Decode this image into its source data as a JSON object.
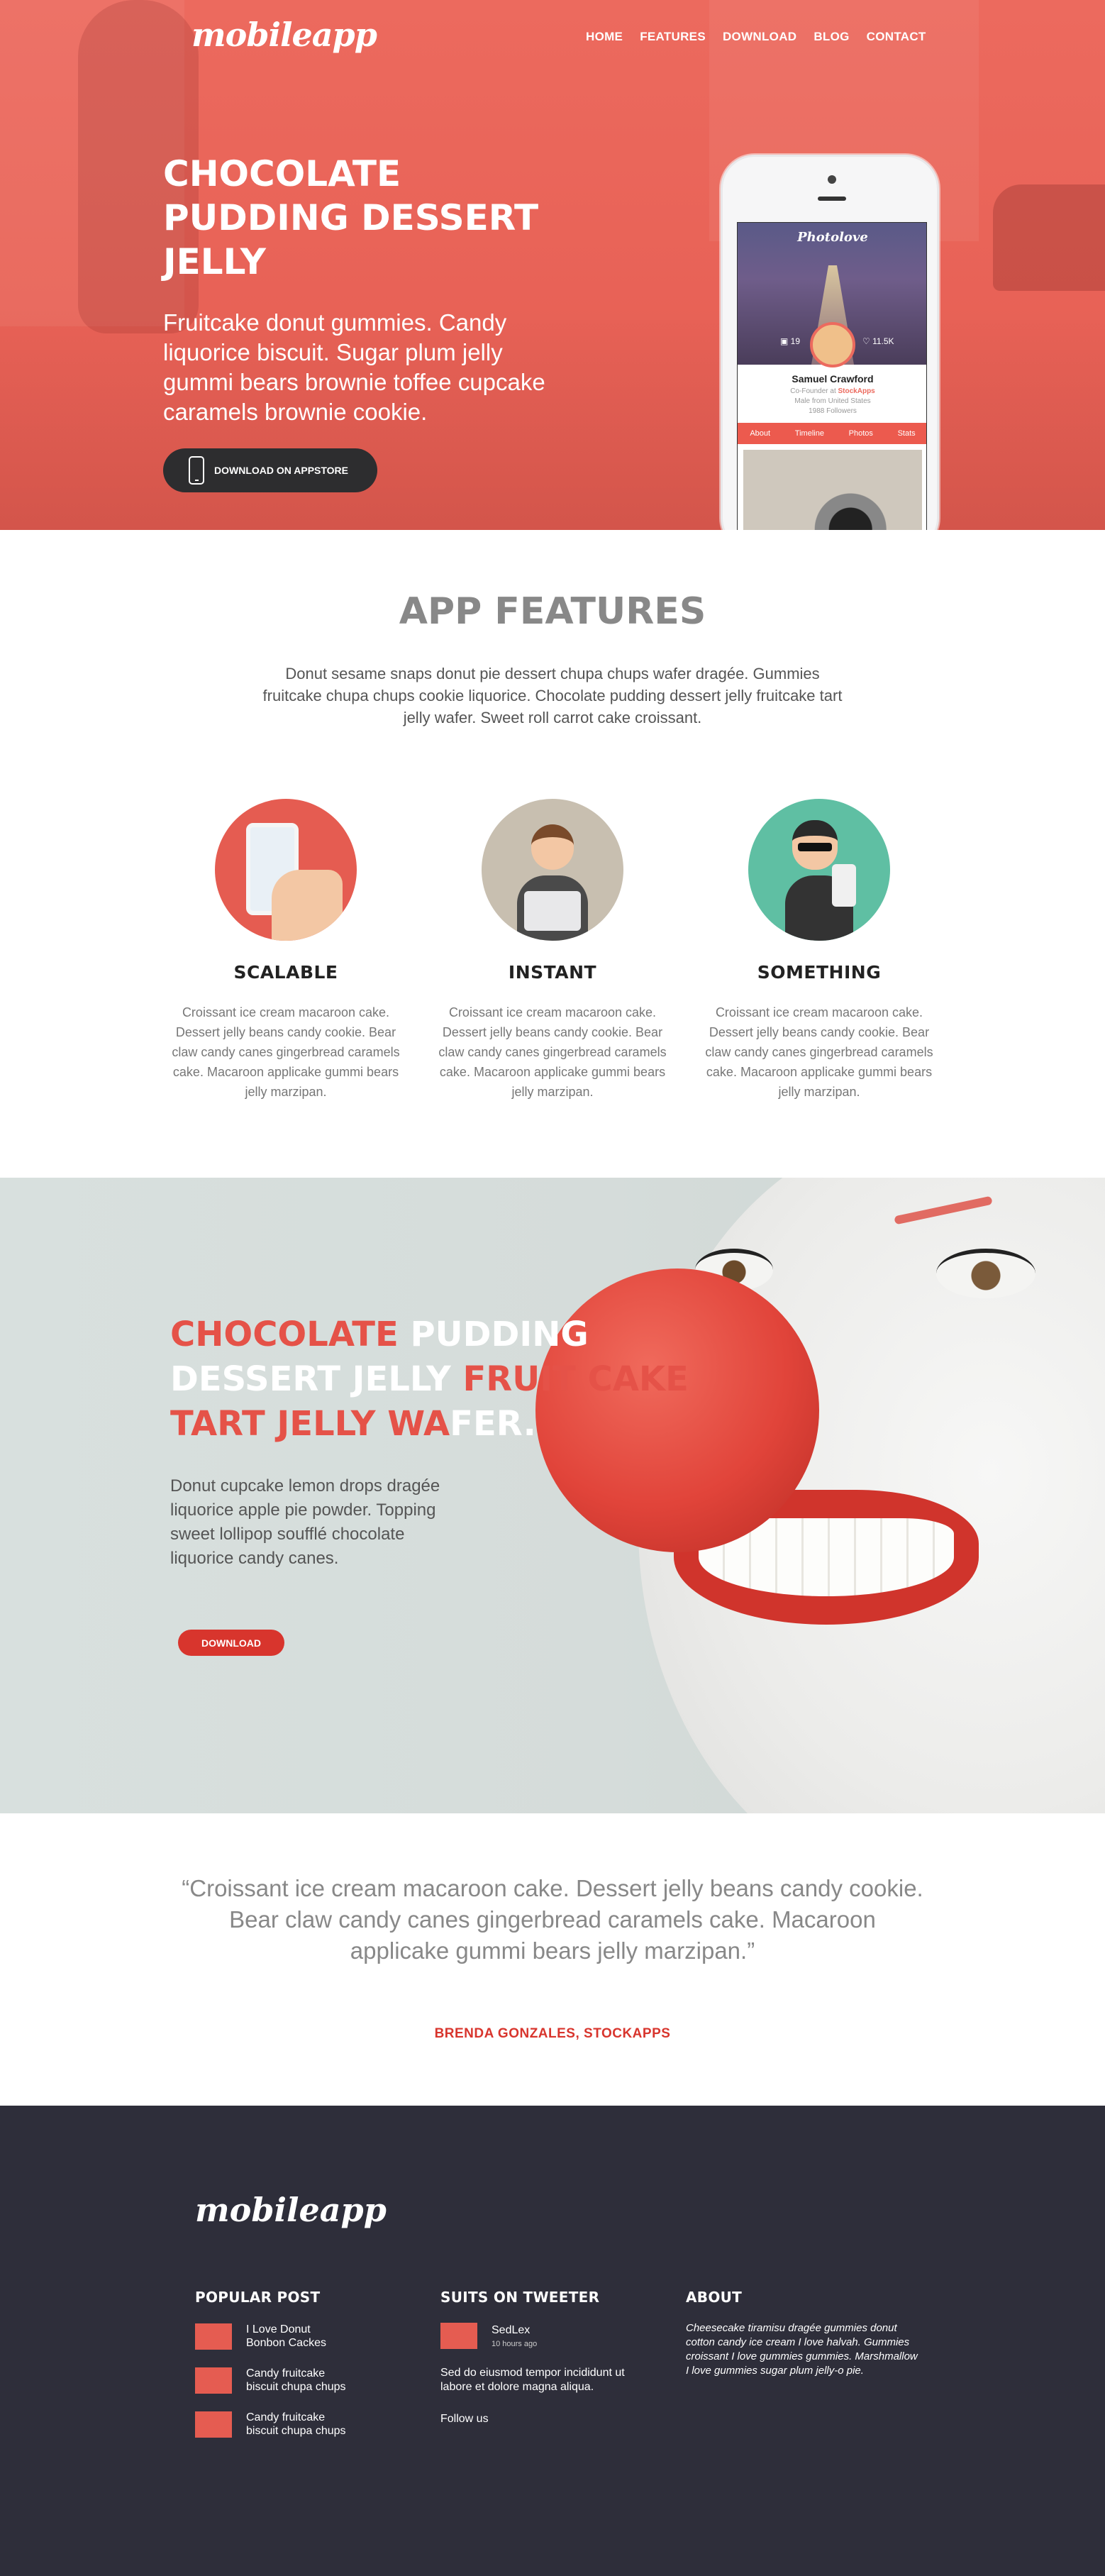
{
  "brand": {
    "logo": "mobileapp",
    "accent": "#e55c51",
    "dark": "#2e2e3a"
  },
  "nav": {
    "items": [
      "HOME",
      "FEATURES",
      "DOWNLOAD",
      "BLOG",
      "CONTACT"
    ]
  },
  "hero": {
    "title": "CHOCOLATE PUDDING DESSERT JELLY",
    "subtitle": "Fruitcake donut gummies. Candy liquorice biscuit. Sugar plum jelly gummi bears brownie toffee cupcake caramels brownie cookie.",
    "button": "DOWNLOAD ON APPSTORE",
    "phone": {
      "app_name": "Photolove",
      "stat_left": "19",
      "stat_right": "11.5K",
      "name": "Samuel Crawford",
      "role_prefix": "Co-Founder at",
      "role_company": "StockApps",
      "location": "Male from United States",
      "followers": "1988 Followers",
      "tabs": [
        "About",
        "Timeline",
        "Photos",
        "Stats"
      ]
    }
  },
  "features": {
    "title": "APP FEATURES",
    "intro": "Donut sesame snaps donut pie dessert chupa chups wafer dragée. Gummies fruitcake chupa chups cookie liquorice. Chocolate pudding dessert jelly fruitcake tart jelly wafer. Sweet roll carrot cake croissant.",
    "items": [
      {
        "title": "SCALABLE",
        "text": "Croissant ice cream macaroon cake. Dessert jelly beans candy cookie. Bear claw candy canes gingerbread caramels cake. Macaroon applicake gummi bears jelly marzipan.",
        "icon": "hand-phone-icon",
        "color": "#e55c51"
      },
      {
        "title": "INSTANT",
        "text": "Croissant ice cream macaroon cake. Dessert jelly beans candy cookie. Bear claw candy canes gingerbread caramels cake. Macaroon applicake gummi bears jelly marzipan.",
        "icon": "laptop-person-icon",
        "color": "#c8bfb0"
      },
      {
        "title": "SOMETHING",
        "text": "Croissant ice cream macaroon cake. Dessert jelly beans candy cookie. Bear claw candy canes gingerbread caramels cake. Macaroon applicake gummi bears jelly marzipan.",
        "icon": "thumbs-up-person-icon",
        "color": "#5fbfa3"
      }
    ]
  },
  "promo": {
    "title_red_1": "CHOCOLATE",
    "title_white_1": "PUDDING",
    "title_white_2": "DESSERT JELLY",
    "title_red_2": "FRUIT CAKE TART JELLY WA",
    "title_white_3": "FER.",
    "text": "Donut cupcake lemon drops dragée liquorice apple pie powder. Topping sweet lollipop soufflé chocolate liquorice candy canes.",
    "button": "DOWNLOAD"
  },
  "testimonial": {
    "quote": "“Croissant ice cream macaroon cake. Dessert jelly beans candy cookie. Bear claw candy canes gingerbread caramels cake. Macaroon applicake gummi bears jelly marzipan.”",
    "author": "BRENDA GONZALES, STOCKAPPS"
  },
  "footer": {
    "logo": "mobileapp",
    "popular": {
      "title": "POPULAR POST",
      "posts": [
        "I Love Donut Bonbon Cackes",
        "Candy fruitcake biscuit chupa chups",
        "Candy fruitcake biscuit chupa chups"
      ]
    },
    "tweets": {
      "title": "SUITS ON TWEETER",
      "user": "SedLex",
      "time": "10 hours ago",
      "text": "Sed do eiusmod tempor incididunt ut labore et dolore magna aliqua.",
      "follow": "Follow us"
    },
    "about": {
      "title": "ABOUT",
      "text": "Cheesecake tiramisu dragée gummies donut cotton candy ice cream I love halvah. Gummies croissant I love gummies gummies. Marshmallow I love gummies sugar plum jelly-o pie."
    }
  }
}
